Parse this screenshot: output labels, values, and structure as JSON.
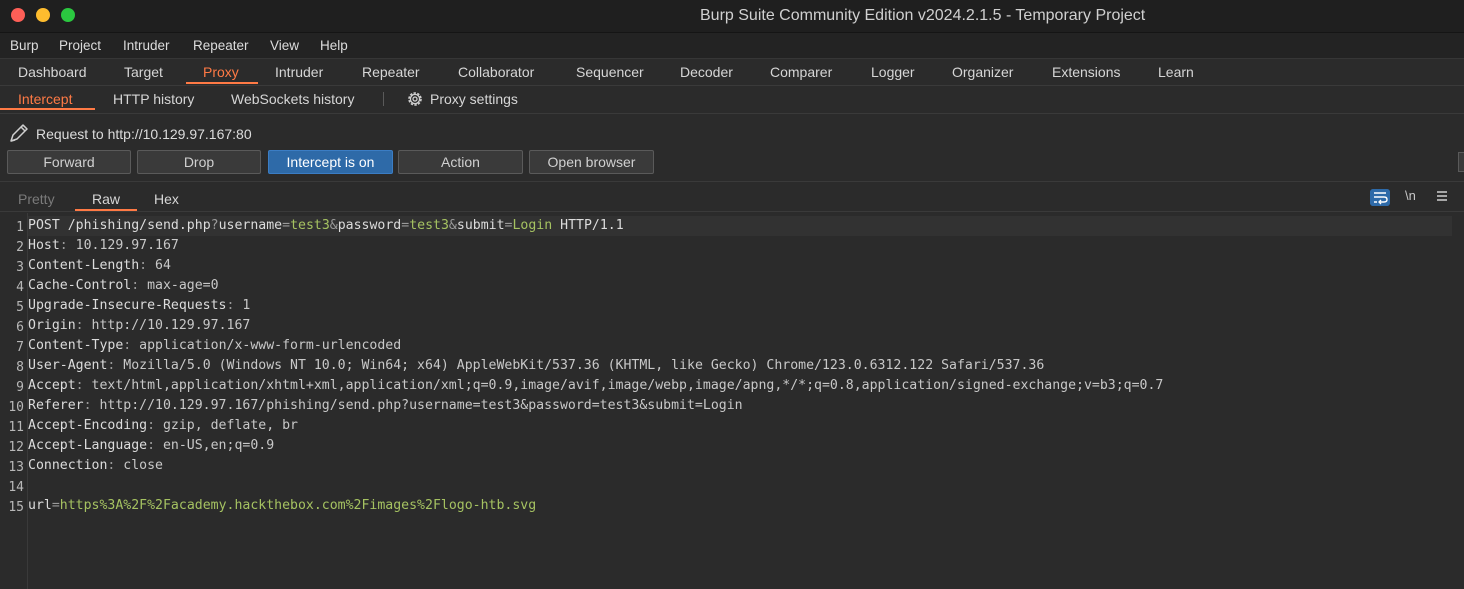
{
  "window": {
    "title": "Burp Suite Community Edition v2024.2.1.5 - Temporary Project"
  },
  "menu": [
    "Burp",
    "Project",
    "Intruder",
    "Repeater",
    "View",
    "Help"
  ],
  "tabs": [
    "Dashboard",
    "Target",
    "Proxy",
    "Intruder",
    "Repeater",
    "Collaborator",
    "Sequencer",
    "Decoder",
    "Comparer",
    "Logger",
    "Organizer",
    "Extensions",
    "Learn"
  ],
  "active_tab": "Proxy",
  "subtabs": [
    "Intercept",
    "HTTP history",
    "WebSockets history"
  ],
  "proxy_settings_label": "Proxy settings",
  "request_label": "Request to http://10.129.97.167:80",
  "buttons": {
    "forward": "Forward",
    "drop": "Drop",
    "intercept": "Intercept is on",
    "action": "Action",
    "open_browser": "Open browser"
  },
  "editor_tabs": [
    "Pretty",
    "Raw",
    "Hex"
  ],
  "editor_active": "Raw",
  "newline_label": "\\n",
  "request": {
    "method": "POST",
    "path": "/phishing/send.php",
    "params": [
      {
        "name": "username",
        "value": "test3"
      },
      {
        "name": "password",
        "value": "test3"
      },
      {
        "name": "submit",
        "value": "Login"
      }
    ],
    "protocol": "HTTP/1.1",
    "headers": [
      {
        "name": "Host",
        "value": "10.129.97.167"
      },
      {
        "name": "Content-Length",
        "value": "64"
      },
      {
        "name": "Cache-Control",
        "value": "max-age=0"
      },
      {
        "name": "Upgrade-Insecure-Requests",
        "value": "1"
      },
      {
        "name": "Origin",
        "value": "http://10.129.97.167"
      },
      {
        "name": "Content-Type",
        "value": "application/x-www-form-urlencoded"
      },
      {
        "name": "User-Agent",
        "value": "Mozilla/5.0 (Windows NT 10.0; Win64; x64) AppleWebKit/537.36 (KHTML, like Gecko) Chrome/123.0.6312.122 Safari/537.36"
      },
      {
        "name": "Accept",
        "value": "text/html,application/xhtml+xml,application/xml;q=0.9,image/avif,image/webp,image/apng,*/*;q=0.8,application/signed-exchange;v=b3;q=0.7"
      },
      {
        "name": "Referer",
        "value": "http://10.129.97.167/phishing/send.php?username=test3&password=test3&submit=Login"
      },
      {
        "name": "Accept-Encoding",
        "value": "gzip, deflate, br"
      },
      {
        "name": "Accept-Language",
        "value": "en-US,en;q=0.9"
      },
      {
        "name": "Connection",
        "value": "close"
      }
    ],
    "body": {
      "name": "url",
      "value": "https%3A%2F%2Facademy.hackthebox.com%2Fimages%2Flogo-htb.svg"
    }
  },
  "line_numbers": [
    "1",
    "2",
    "3",
    "4",
    "5",
    "6",
    "7",
    "8",
    "9",
    "10",
    "11",
    "12",
    "13",
    "14",
    "15"
  ],
  "colors": {
    "accent": "#ff7a45",
    "intercept_on": "#2e6aa8",
    "param_value": "#a5c261"
  }
}
